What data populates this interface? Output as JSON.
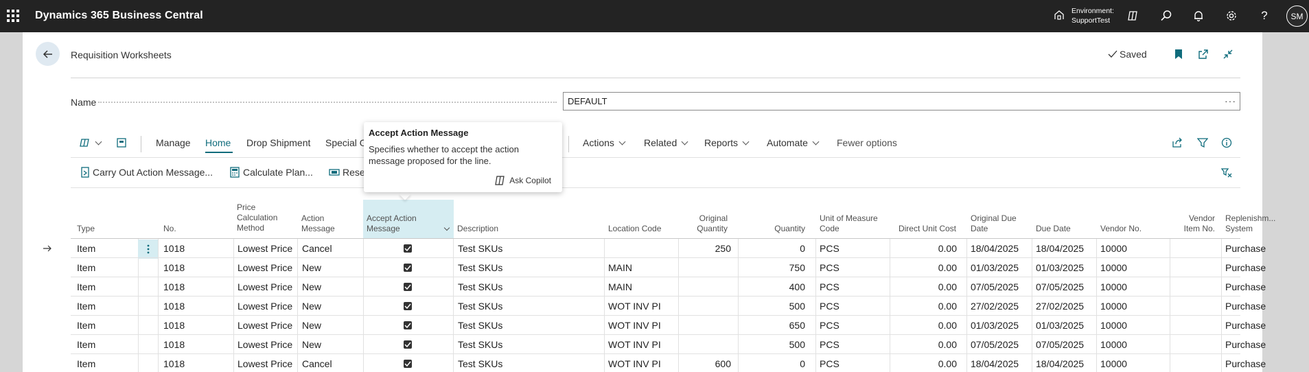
{
  "app": {
    "title": "Dynamics 365 Business Central",
    "environment_label": "Environment:",
    "environment_value": "SupportTest",
    "user_initials": "SM"
  },
  "page": {
    "title": "Requisition Worksheets",
    "saved_label": "Saved",
    "name_label": "Name",
    "name_value": "DEFAULT"
  },
  "actionbar": {
    "items": [
      "Manage",
      "Home",
      "Drop Shipment",
      "Special O",
      "Actions",
      "Related",
      "Reports",
      "Automate",
      "Fewer options"
    ],
    "active": "Home"
  },
  "subbar": {
    "items": [
      "Carry Out Action Message...",
      "Calculate Plan...",
      "Rese"
    ]
  },
  "tooltip": {
    "title": "Accept Action Message",
    "body": "Specifies whether to accept the action message proposed for the line.",
    "copilot": "Ask Copilot"
  },
  "columns": {
    "type": "Type",
    "no": "No.",
    "price_calc_1": "Price",
    "price_calc_2": "Calculation",
    "price_calc_3": "Method",
    "action_msg_1": "Action",
    "action_msg_2": "Message",
    "accept_1": "Accept Action",
    "accept_2": "Message",
    "description": "Description",
    "location": "Location Code",
    "orig_qty_1": "Original",
    "orig_qty_2": "Quantity",
    "quantity": "Quantity",
    "uom_1": "Unit of Measure",
    "uom_2": "Code",
    "direct_cost": "Direct Unit Cost",
    "orig_due_1": "Original Due",
    "orig_due_2": "Date",
    "due_date": "Due Date",
    "vendor_no": "Vendor No.",
    "vendor_item_1": "Vendor",
    "vendor_item_2": "Item No.",
    "replenish_1": "Replenishm...",
    "replenish_2": "System"
  },
  "rows": [
    {
      "type": "Item",
      "no": "1018",
      "price": "Lowest Price",
      "action": "Cancel",
      "accept": true,
      "desc": "Test SKUs",
      "loc": "",
      "orig_qty": "250",
      "qty": "0",
      "uom": "PCS",
      "cost": "0.00",
      "orig_due": "18/04/2025",
      "due": "18/04/2025",
      "vendor": "10000",
      "vendor_item": "",
      "repl": "Purchase"
    },
    {
      "type": "Item",
      "no": "1018",
      "price": "Lowest Price",
      "action": "New",
      "accept": true,
      "desc": "Test SKUs",
      "loc": "MAIN",
      "orig_qty": "",
      "qty": "750",
      "uom": "PCS",
      "cost": "0.00",
      "orig_due": "01/03/2025",
      "due": "01/03/2025",
      "vendor": "10000",
      "vendor_item": "",
      "repl": "Purchase"
    },
    {
      "type": "Item",
      "no": "1018",
      "price": "Lowest Price",
      "action": "New",
      "accept": true,
      "desc": "Test SKUs",
      "loc": "MAIN",
      "orig_qty": "",
      "qty": "400",
      "uom": "PCS",
      "cost": "0.00",
      "orig_due": "07/05/2025",
      "due": "07/05/2025",
      "vendor": "10000",
      "vendor_item": "",
      "repl": "Purchase"
    },
    {
      "type": "Item",
      "no": "1018",
      "price": "Lowest Price",
      "action": "New",
      "accept": true,
      "desc": "Test SKUs",
      "loc": "WOT INV PI",
      "orig_qty": "",
      "qty": "500",
      "uom": "PCS",
      "cost": "0.00",
      "orig_due": "27/02/2025",
      "due": "27/02/2025",
      "vendor": "10000",
      "vendor_item": "",
      "repl": "Purchase"
    },
    {
      "type": "Item",
      "no": "1018",
      "price": "Lowest Price",
      "action": "New",
      "accept": true,
      "desc": "Test SKUs",
      "loc": "WOT INV PI",
      "orig_qty": "",
      "qty": "650",
      "uom": "PCS",
      "cost": "0.00",
      "orig_due": "01/03/2025",
      "due": "01/03/2025",
      "vendor": "10000",
      "vendor_item": "",
      "repl": "Purchase"
    },
    {
      "type": "Item",
      "no": "1018",
      "price": "Lowest Price",
      "action": "New",
      "accept": true,
      "desc": "Test SKUs",
      "loc": "WOT INV PI",
      "orig_qty": "",
      "qty": "500",
      "uom": "PCS",
      "cost": "0.00",
      "orig_due": "07/05/2025",
      "due": "07/05/2025",
      "vendor": "10000",
      "vendor_item": "",
      "repl": "Purchase"
    },
    {
      "type": "Item",
      "no": "1018",
      "price": "Lowest Price",
      "action": "Cancel",
      "accept": true,
      "desc": "Test SKUs",
      "loc": "WOT INV PI",
      "orig_qty": "600",
      "qty": "0",
      "uom": "PCS",
      "cost": "0.00",
      "orig_due": "18/04/2025",
      "due": "18/04/2025",
      "vendor": "10000",
      "vendor_item": "",
      "repl": "Purchase"
    }
  ],
  "colors": {
    "topbar": "#232323",
    "accent": "#0f6c7c",
    "highlight": "#d6edf2"
  }
}
